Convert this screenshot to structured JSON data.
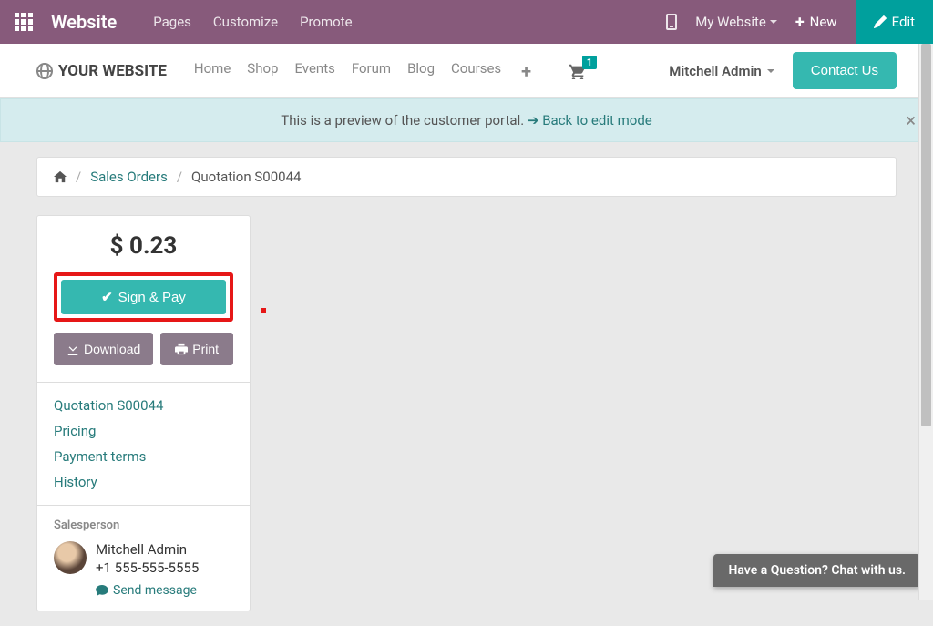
{
  "topbar": {
    "title": "Website",
    "menu": [
      "Pages",
      "Customize",
      "Promote"
    ],
    "website_selector": "My Website",
    "new_label": "New",
    "edit_label": "Edit"
  },
  "site_header": {
    "logo_text": "YOUR WEBSITE",
    "nav": [
      "Home",
      "Shop",
      "Events",
      "Forum",
      "Blog",
      "Courses"
    ],
    "cart_count": "1",
    "user_name": "Mitchell Admin",
    "contact_label": "Contact Us"
  },
  "preview_banner": {
    "text": "This is a preview of the customer portal. ",
    "link_text": "Back to edit mode"
  },
  "breadcrumb": {
    "sales_orders": "Sales Orders",
    "current": "Quotation S00044"
  },
  "sidebar": {
    "price": "$ 0.23",
    "sign_pay_label": "Sign & Pay",
    "download_label": "Download",
    "print_label": "Print",
    "nav_links": [
      "Quotation S00044",
      "Pricing",
      "Payment terms",
      "History"
    ],
    "salesperson": {
      "label": "Salesperson",
      "name": "Mitchell Admin",
      "phone": "+1 555-555-5555",
      "send_message": "Send message"
    }
  },
  "chat_widget": "Have a Question? Chat with us."
}
